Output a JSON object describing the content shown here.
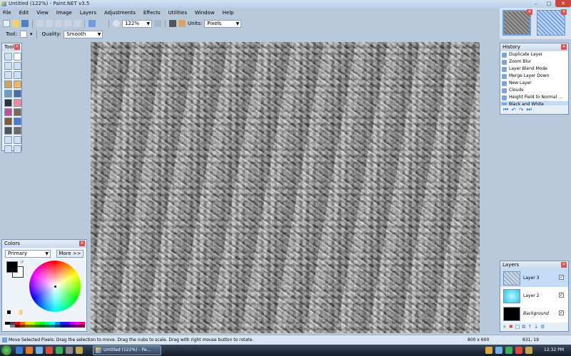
{
  "window": {
    "title": "Untitled (122%) - Paint.NET v3.5",
    "minimize": "–",
    "maximize": "□",
    "close": "✕"
  },
  "menu": [
    "File",
    "Edit",
    "View",
    "Image",
    "Layers",
    "Adjustments",
    "Effects",
    "Utilities",
    "Window",
    "Help"
  ],
  "toolbar": {
    "zoom_value": "122%",
    "units_label": "Units:",
    "units_value": "Pixels",
    "tool_label": "Tool:",
    "quality_label": "Quality:",
    "quality_value": "Smooth"
  },
  "tools_panel": {
    "title": "Tools",
    "close": "✕",
    "tool_names": [
      "rectangle-select",
      "move-selected-pixels",
      "lasso-select",
      "move-selection",
      "ellipse-select",
      "zoom",
      "magic-wand",
      "pan",
      "paint-bucket",
      "gradient",
      "paintbrush",
      "eraser",
      "pencil",
      "color-picker",
      "clone-stamp",
      "recolor",
      "text",
      "line-curve",
      "rectangle",
      "rounded-rectangle",
      "ellipse",
      "freeform-shape"
    ]
  },
  "history_panel": {
    "title": "History",
    "close": "✕",
    "items": [
      "Duplicate Layer",
      "Zoom Blur",
      "Layer Blend Mode",
      "Merge Layer Down",
      "New Layer",
      "Clouds",
      "Height Field to Normal ...",
      "Black and White"
    ],
    "selected_index": 7,
    "controls": [
      "⏮",
      "↶",
      "↷",
      "⏭"
    ]
  },
  "colors_panel": {
    "title": "Colors",
    "close": "✕",
    "mode_value": "Primary",
    "more_label": "More >>",
    "primary_color": "#000000",
    "secondary_color": "#ffffff",
    "palette_top": [
      "#000000",
      "#404040",
      "#ff0000",
      "#ff6a00",
      "#ffd800",
      "#b6ff00",
      "#4cff00",
      "#00ff21",
      "#00ff90",
      "#00ffff",
      "#0094ff",
      "#0026ff",
      "#4800ff",
      "#b200ff",
      "#ff00dc",
      "#ff006e"
    ],
    "palette_bottom": [
      "#ffffff",
      "#808080",
      "#7f0000",
      "#7f3300",
      "#7f6a00",
      "#5b7f00",
      "#267f00",
      "#007f0e",
      "#007f46",
      "#007f7f",
      "#004a7f",
      "#00137f",
      "#21007f",
      "#57007f",
      "#7f006e",
      "#7f0037"
    ]
  },
  "layers_panel": {
    "title": "Layers",
    "close": "✕",
    "layers": [
      {
        "name": "Layer 3",
        "checked": "✓"
      },
      {
        "name": "Layer 2",
        "checked": "✓"
      },
      {
        "name": "Background",
        "checked": "✓"
      }
    ],
    "controls": [
      "+",
      "✖",
      "□",
      "⧉",
      "↑",
      "↓",
      "⚙"
    ]
  },
  "statusbar": {
    "text": "Move Selected Pixels: Drag the selection to move. Drag the nubs to scale. Drag with right mouse button to rotate.",
    "image_size": "800 x 600",
    "cursor_position": "831, 19"
  },
  "taskbar": {
    "task_label": "Untitled (122%) - Pa...",
    "clock": "12:32 PM"
  }
}
